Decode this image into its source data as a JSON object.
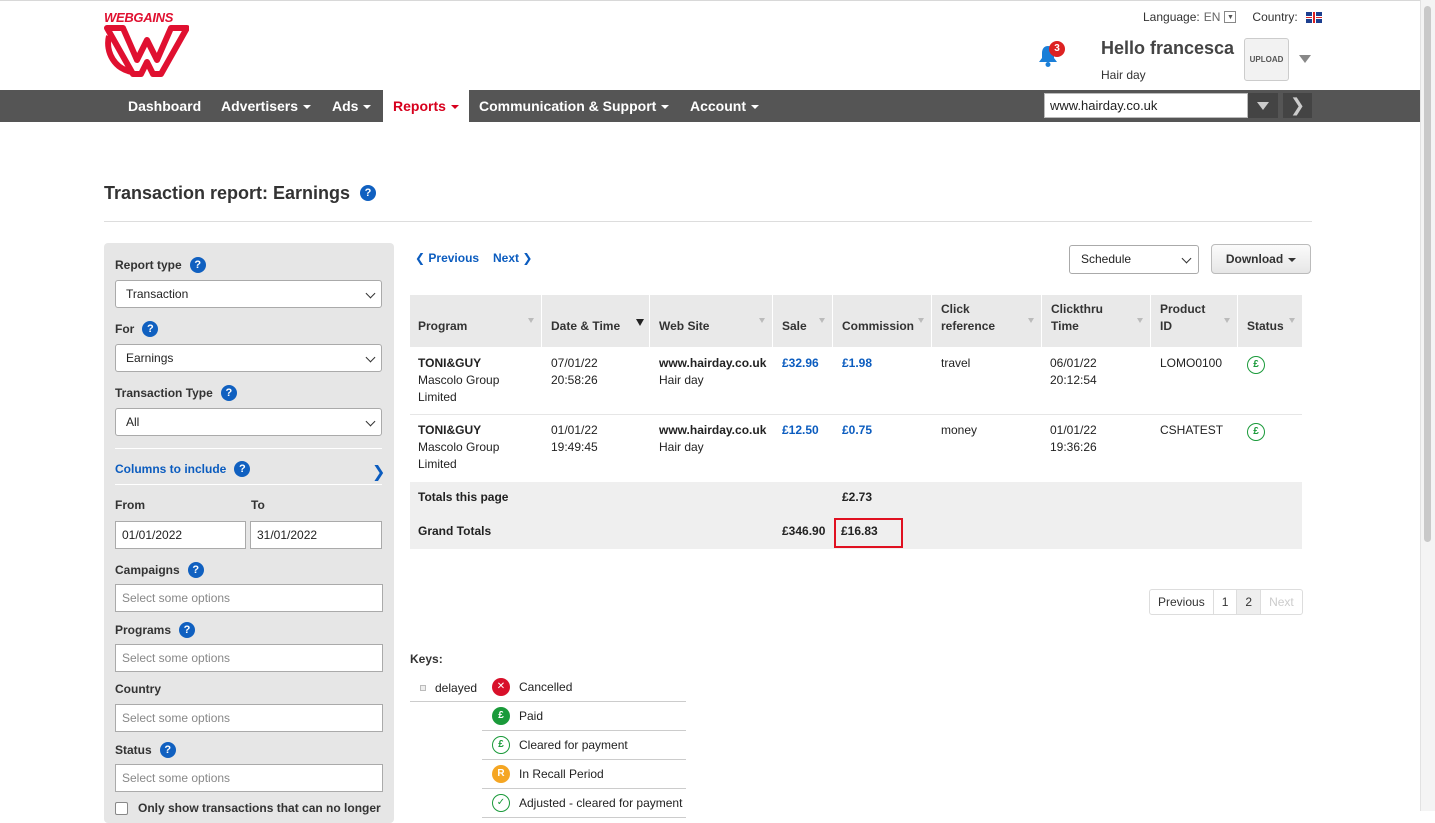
{
  "brand": {
    "logo_text": "WEBGAINS",
    "accent": "#e01030",
    "link_color": "#0b5cbf"
  },
  "header": {
    "language_label": "Language:",
    "language_value": "EN",
    "country_label": "Country:",
    "notifications_count": "3",
    "greeting": "Hello francesca",
    "account_name": "Hair day",
    "avatar_text": "UPLOAD"
  },
  "nav": {
    "items": [
      {
        "label": "Dashboard"
      },
      {
        "label": "Advertisers"
      },
      {
        "label": "Ads"
      },
      {
        "label": "Reports"
      },
      {
        "label": "Communication & Support"
      },
      {
        "label": "Account"
      }
    ],
    "active": "Reports",
    "site_value": "www.hairday.co.uk",
    "go_symbol": "❯"
  },
  "page": {
    "title": "Transaction report: Earnings"
  },
  "filters": {
    "report_type_label": "Report type",
    "report_type_value": "Transaction",
    "for_label": "For",
    "for_value": "Earnings",
    "transaction_type_label": "Transaction Type",
    "transaction_type_value": "All",
    "columns_link": "Columns to include",
    "from_label": "From",
    "from_value": "01/01/2022",
    "to_label": "To",
    "to_value": "31/01/2022",
    "campaigns_label": "Campaigns",
    "campaigns_placeholder": "Select some options",
    "programs_label": "Programs",
    "programs_placeholder": "Select some options",
    "country_label": "Country",
    "country_placeholder": "Select some options",
    "status_label": "Status",
    "status_placeholder": "Select some options",
    "checkbox_label": "Only show transactions that can no longer"
  },
  "toolbar": {
    "previous": "❮ Previous",
    "next": "Next ❯",
    "schedule_value": "Schedule",
    "download_label": "Download"
  },
  "table": {
    "headers": [
      "Program",
      "Date & Time",
      "Web Site",
      "Sale",
      "Commission",
      "Click reference",
      "Clickthru Time",
      "Product ID",
      "Status"
    ],
    "rows": [
      {
        "program_name": "TONI&GUY",
        "program_company": "Mascolo Group Limited",
        "date": "07/01/22",
        "time": "20:58:26",
        "site": "www.hairday.co.uk",
        "site_name": "Hair day",
        "sale": "£32.96",
        "commission": "£1.98",
        "click_reference": "travel",
        "clickthru_date": "06/01/22",
        "clickthru_time": "20:12:54",
        "product_id": "LOMO0100",
        "status_icon": "cleared-for-payment-icon"
      },
      {
        "program_name": "TONI&GUY",
        "program_company": "Mascolo Group Limited",
        "date": "01/01/22",
        "time": "19:49:45",
        "site": "www.hairday.co.uk",
        "site_name": "Hair day",
        "sale": "£12.50",
        "commission": "£0.75",
        "click_reference": "money",
        "clickthru_date": "01/01/22",
        "clickthru_time": "19:36:26",
        "product_id": "CSHATEST",
        "status_icon": "cleared-for-payment-icon"
      }
    ],
    "totals_page_label": "Totals this page",
    "totals_page_commission": "£2.73",
    "grand_totals_label": "Grand Totals",
    "grand_totals_sale": "£346.90",
    "grand_totals_commission": "£16.83"
  },
  "pagination": {
    "previous": "Previous",
    "pages": [
      "1",
      "2"
    ],
    "next": "Next",
    "current": "2"
  },
  "keys": {
    "title": "Keys:",
    "delayed": "delayed",
    "items": [
      {
        "label": "Cancelled",
        "color": "#d8102a",
        "glyph": "✕"
      },
      {
        "label": "Paid",
        "color": "#1a9a3a",
        "glyph": "£"
      },
      {
        "label": "Cleared for payment",
        "color": "#1a9a3a",
        "glyph": "£"
      },
      {
        "label": "In Recall Period",
        "color": "#f5a623",
        "glyph": "R"
      },
      {
        "label": "Adjusted - cleared for payment",
        "color": "#1a9a3a",
        "glyph": "✓"
      }
    ]
  }
}
